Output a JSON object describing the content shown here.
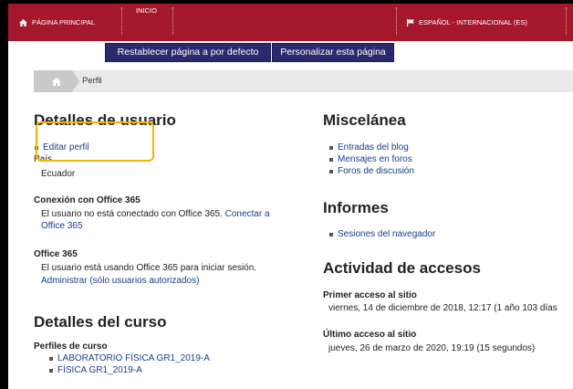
{
  "topbar": {
    "home_label": "PÁGINA PRINCIPAL",
    "inicio_label": "INICIO",
    "language_label": "ESPAÑOL - INTERNACIONAL (ES)"
  },
  "page_buttons": {
    "reset": "Restablecer página a por defecto",
    "customize": "Personalizar esta página"
  },
  "breadcrumb": {
    "current": "Perfil"
  },
  "user_details": {
    "heading": "Detalles de usuario",
    "edit_profile": "Editar perfil",
    "country_label": "País",
    "country_value": "Ecuador",
    "office_conn_label": "Conexión con Office 365",
    "office_conn_text": "El usuario no está conectado con Office 365.",
    "office_conn_link_1": "Conectar a",
    "office_conn_link_2": "Office 365",
    "office365_label": "Office 365",
    "office365_text": "El usuario está usando Office 365 para iniciar sesión.",
    "office365_link": "Administrar (sólo usuarios autorizados)"
  },
  "course_details": {
    "heading": "Detalles del curso",
    "profiles_label": "Perfiles de curso",
    "courses": [
      "LABORATORIO FÍSICA GR1_2019-A",
      "FÍSICA GR1_2019-A"
    ]
  },
  "misc": {
    "heading": "Miscelánea",
    "items": [
      "Entradas del blog",
      "Mensajes en foros",
      "Foros de discusión"
    ]
  },
  "reports": {
    "heading": "Informes",
    "items": [
      "Sesiones del navegador"
    ]
  },
  "access": {
    "heading": "Actividad de accesos",
    "first_label": "Primer acceso al sitio",
    "first_value": "viernes, 14 de diciembre de 2018, 12:17  (1 año 103 días",
    "last_label": "Último acceso al sitio",
    "last_value": "jueves, 26 de marzo de 2020, 19:19  (15 segundos)"
  },
  "colors": {
    "header": "#a5182c",
    "button": "#2a2a6e",
    "link": "#1a3e8c",
    "highlight": "#f5b400"
  }
}
